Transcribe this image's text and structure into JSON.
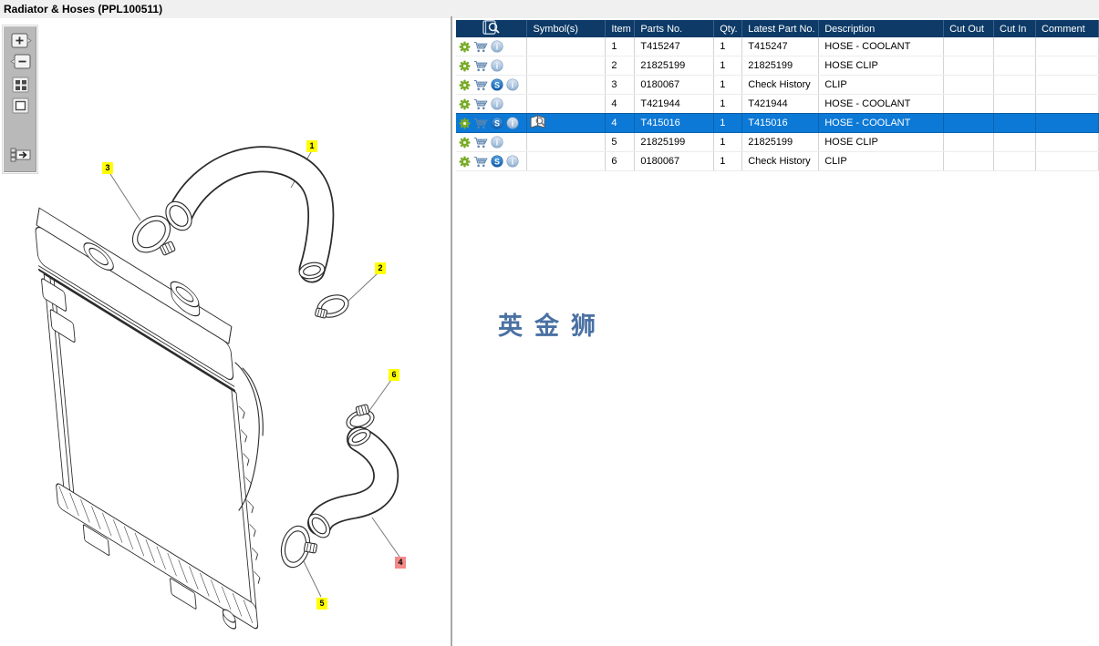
{
  "window": {
    "title": "Radiator & Hoses (PPL100511)"
  },
  "toolbar": {
    "buttons": [
      {
        "name": "zoom-in"
      },
      {
        "name": "zoom-out"
      },
      {
        "name": "tile-view"
      },
      {
        "name": "fit-to-window"
      },
      {
        "name": "toggle-panel"
      }
    ]
  },
  "diagram": {
    "callouts": [
      {
        "label": "1",
        "highlighted": false
      },
      {
        "label": "2",
        "highlighted": false
      },
      {
        "label": "3",
        "highlighted": false
      },
      {
        "label": "4",
        "highlighted": true
      },
      {
        "label": "5",
        "highlighted": false
      },
      {
        "label": "6",
        "highlighted": false
      }
    ]
  },
  "watermark": {
    "text": "英金狮"
  },
  "table": {
    "header": {
      "symbols": "Symbol(s)",
      "item": "Item",
      "parts_no": "Parts No.",
      "qty": "Qty.",
      "latest_part_no": "Latest Part No.",
      "description": "Description",
      "cut_out": "Cut Out",
      "cut_in": "Cut In",
      "comment": "Comment"
    },
    "rows": [
      {
        "item": "1",
        "parts_no": "T415247",
        "qty": "1",
        "latest_part_no": "T415247",
        "description": "HOSE - COOLANT",
        "cut_out": "",
        "cut_in": "",
        "comment": "",
        "selected": false,
        "has_substitute_icon": false,
        "has_symbol": false
      },
      {
        "item": "2",
        "parts_no": "21825199",
        "qty": "1",
        "latest_part_no": "21825199",
        "description": "HOSE CLIP",
        "cut_out": "",
        "cut_in": "",
        "comment": "",
        "selected": false,
        "has_substitute_icon": false,
        "has_symbol": false
      },
      {
        "item": "3",
        "parts_no": "0180067",
        "qty": "1",
        "latest_part_no": "Check History",
        "description": "CLIP",
        "cut_out": "",
        "cut_in": "",
        "comment": "",
        "selected": false,
        "has_substitute_icon": true,
        "has_symbol": false
      },
      {
        "item": "4",
        "parts_no": "T421944",
        "qty": "1",
        "latest_part_no": "T421944",
        "description": "HOSE - COOLANT",
        "cut_out": "",
        "cut_in": "",
        "comment": "",
        "selected": false,
        "has_substitute_icon": false,
        "has_symbol": false
      },
      {
        "item": "4",
        "parts_no": "T415016",
        "qty": "1",
        "latest_part_no": "T415016",
        "description": "HOSE - COOLANT",
        "cut_out": "",
        "cut_in": "",
        "comment": "",
        "selected": true,
        "has_substitute_icon": true,
        "has_symbol": true
      },
      {
        "item": "5",
        "parts_no": "21825199",
        "qty": "1",
        "latest_part_no": "21825199",
        "description": "HOSE CLIP",
        "cut_out": "",
        "cut_in": "",
        "comment": "",
        "selected": false,
        "has_substitute_icon": false,
        "has_symbol": false
      },
      {
        "item": "6",
        "parts_no": "0180067",
        "qty": "1",
        "latest_part_no": "Check History",
        "description": "CLIP",
        "cut_out": "",
        "cut_in": "",
        "comment": "",
        "selected": false,
        "has_substitute_icon": true,
        "has_symbol": false
      }
    ]
  },
  "colors": {
    "header_bg": "#0d3a67",
    "selected_row": "#0d79d6",
    "callout": "#ffff00",
    "callout_selected": "#f48a8a",
    "watermark": "#4a71a3",
    "action_green": "#79aa28",
    "action_blue": "#5f85ad"
  }
}
